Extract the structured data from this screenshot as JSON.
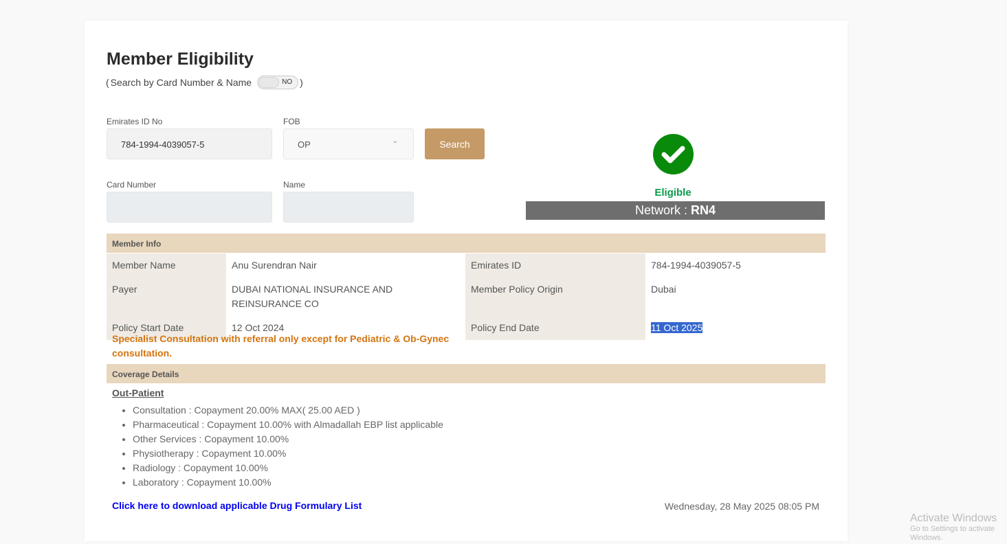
{
  "title": "Member Eligibility",
  "search_toggle": {
    "open": "(",
    "label": "Search by Card Number & Name",
    "state": "NO",
    "close": ")"
  },
  "form": {
    "emirates_label": "Emirates ID No",
    "emirates_value": "784-1994-4039057-5",
    "fob_label": "FOB",
    "fob_value": "OP",
    "search_label": "Search",
    "card_label": "Card Number",
    "card_value": "",
    "name_label": "Name",
    "name_value": ""
  },
  "status": {
    "eligible": "Eligible",
    "network_label": "Network :",
    "network_value": "RN4"
  },
  "member_info": {
    "header": "Member Info",
    "rows": [
      {
        "k1": "Member Name",
        "v1": "Anu Surendran Nair",
        "k2": "Emirates ID",
        "v2": "784-1994-4039057-5"
      },
      {
        "k1": "Payer",
        "v1": "DUBAI NATIONAL INSURANCE AND REINSURANCE CO",
        "k2": "Member Policy Origin",
        "v2": "Dubai"
      },
      {
        "k1": "Policy Start Date",
        "v1": "12 Oct 2024",
        "k2": "Policy End Date",
        "v2": "11 Oct 2025"
      }
    ]
  },
  "note": "Specialist Consultation with referral only except for Pediatric & Ob-Gynec consultation.",
  "coverage": {
    "header": "Coverage Details",
    "category": "Out-Patient",
    "items": [
      "Consultation : Copayment 20.00% MAX( 25.00 AED )",
      "Pharmaceutical : Copayment 10.00% with Almadallah EBP list applicable",
      "Other Services : Copayment 10.00%",
      "Physiotherapy : Copayment 10.00%",
      "Radiology : Copayment 10.00%",
      "Laboratory : Copayment 10.00%"
    ]
  },
  "download_link": "Click here to download applicable Drug Formulary List",
  "timestamp": "Wednesday, 28 May 2025 08:05 PM",
  "watermark": {
    "line1": "Activate Windows",
    "line2": "Go to Settings to activate Windows."
  }
}
